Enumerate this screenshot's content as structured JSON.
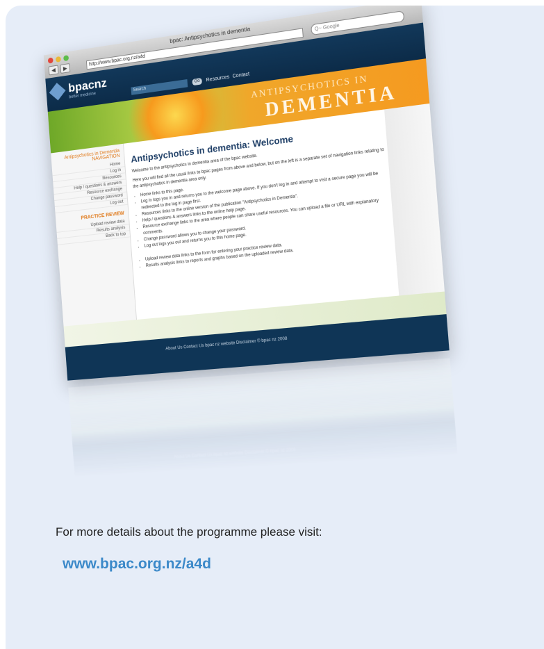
{
  "browser": {
    "window_title": "bpac: Antipsychotics in dementia",
    "url": "http://www.bpac.org.nz/a4d",
    "search_placeholder": "Q~ Google",
    "nav_back": "◀",
    "nav_forward": "▶"
  },
  "site": {
    "logo_text": "bpacnz",
    "logo_sub": "better medicine",
    "search_box_text": "Search",
    "go_label": "Go",
    "top_nav": [
      "Resources",
      "Contact"
    ]
  },
  "banner": {
    "line1": "ANTIPSYCHOTICS IN",
    "line2": "DEMENTIA"
  },
  "sidebar": {
    "title": "Antipsychotics in Dementia NAVIGATION",
    "items": [
      "Home",
      "Log in",
      "Resources",
      "Help / questions & answers",
      "Resource exchange",
      "Change password",
      "Log out"
    ],
    "subtitle": "PRACTICE REVIEW",
    "sub_items": [
      "Upload review data",
      "Results analysis",
      "Back to top"
    ]
  },
  "main": {
    "heading": "Antipsychotics in dementia: Welcome",
    "intro": "Welcome to the antipsychotics in dementia area of the bpac website.",
    "intro2": "Here you will find all the usual links to bpac pages from above and below, but on the left is a separate set of navigation links relating to the antipsychotics in dementia area only.",
    "bullets": [
      "Home links to this page.",
      "Log in logs you in and returns you to the welcome page above. If you don't log in and attempt to visit a secure page you will be redirected to the log in page first.",
      "Resources links to the online version of the publication \"Antipsychotics in Dementia\".",
      "Help / questions & answers links to the online help page.",
      "Resource exchange links to the area where people can share useful resources. You can upload a file or URL with explanatory comments.",
      "Change password allows you to change your password.",
      "Log out logs you out and returns you to this home page."
    ],
    "bullets2": [
      "Upload review data links to the form for entering your practice review data.",
      "Results analysis links to reports and graphs based on the uploaded review data."
    ]
  },
  "footer": {
    "links": "About Us   Contact Us   bpac nz website   Disclaimer   © bpac nz 2008"
  },
  "caption": "For more details about the programme please visit:",
  "link": "www.bpac.org.nz/a4d"
}
